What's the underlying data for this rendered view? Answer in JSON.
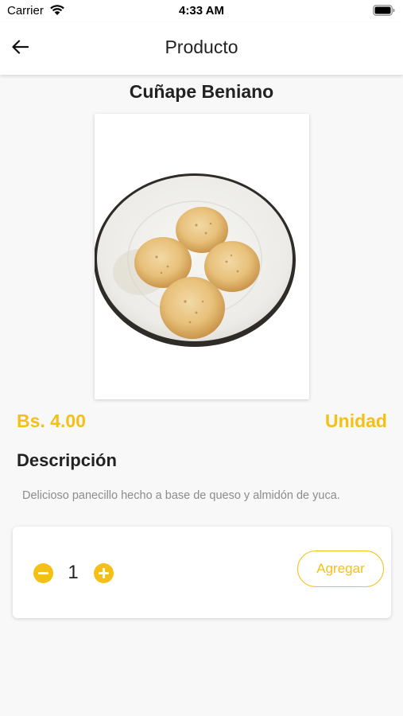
{
  "status_bar": {
    "carrier": "Carrier",
    "time": "4:33 AM",
    "icons": [
      "wifi-icon",
      "battery-icon"
    ]
  },
  "app_bar": {
    "title": "Producto",
    "back_icon": "arrow-left-icon"
  },
  "product": {
    "name": "Cuñape Beniano",
    "image_description_icon": "product-photo",
    "price": "Bs. 4.00",
    "unit": "Unidad",
    "description_heading": "Descripción",
    "description": "Delicioso panecillo hecho a base de queso y almidón de yuca."
  },
  "cart": {
    "quantity": "1",
    "minus_icon": "minus-circle-icon",
    "plus_icon": "plus-circle-icon",
    "add_label": "Agregar"
  },
  "colors": {
    "accent": "#f5c016",
    "background": "#f8f8f8",
    "text": "#222222",
    "muted": "#8c8c8c"
  }
}
